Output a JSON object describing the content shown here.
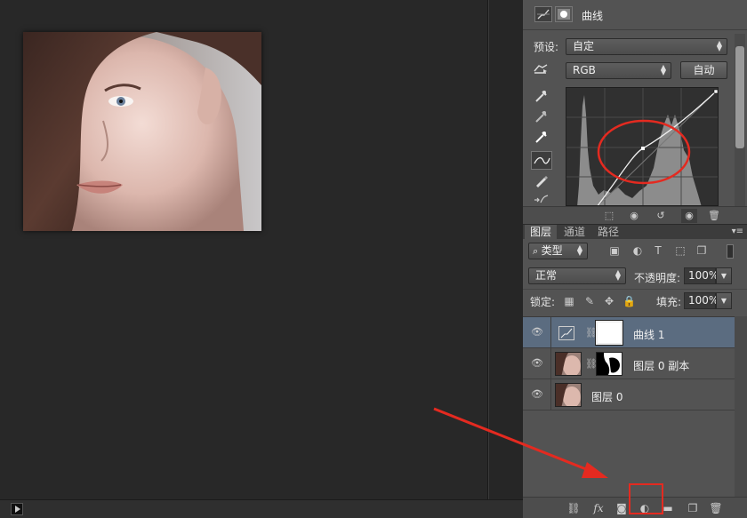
{
  "colors": {
    "canvas_bg": "#282828",
    "panel_bg": "#535353",
    "selected_layer": "#5b6c80",
    "annotation_red": "#e42a20"
  },
  "properties": {
    "title": "曲线",
    "preset_label": "预设:",
    "preset_value": "自定",
    "channel_value": "RGB",
    "auto_button": "自动",
    "header_icons": [
      "curves-adjustment-icon",
      "mask-icon"
    ],
    "tool_icons": [
      "hand-target-icon",
      "black-eyedropper-icon",
      "gray-eyedropper-icon",
      "white-eyedropper-icon",
      "curve-point-tool-icon",
      "pencil-icon",
      "smooth-icon"
    ],
    "footer_icons": [
      "clip-to-layer-icon",
      "view-previous-icon",
      "reset-icon",
      "visibility-icon",
      "delete-icon"
    ]
  },
  "layers_panel": {
    "tabs": [
      {
        "label": "图层",
        "active": true
      },
      {
        "label": "通道",
        "active": false
      },
      {
        "label": "路径",
        "active": false
      }
    ],
    "filter_kind": "类型",
    "blend_mode": "正常",
    "opacity_label": "不透明度:",
    "opacity_value": "100%",
    "lock_label": "锁定:",
    "fill_label": "填充:",
    "fill_value": "100%",
    "layers": [
      {
        "name": "曲线 1",
        "type": "adjustment",
        "selected": true,
        "visible": true
      },
      {
        "name": "图层 0 副本",
        "type": "pixel-with-mask",
        "selected": false,
        "visible": true
      },
      {
        "name": "图层 0",
        "type": "pixel",
        "selected": false,
        "visible": true
      }
    ],
    "footer_icons": [
      "link-layers-icon",
      "fx-icon",
      "add-mask-icon",
      "new-adjustment-layer-icon",
      "new-group-icon",
      "new-layer-icon",
      "delete-layer-icon"
    ],
    "fx_label": "fx"
  }
}
